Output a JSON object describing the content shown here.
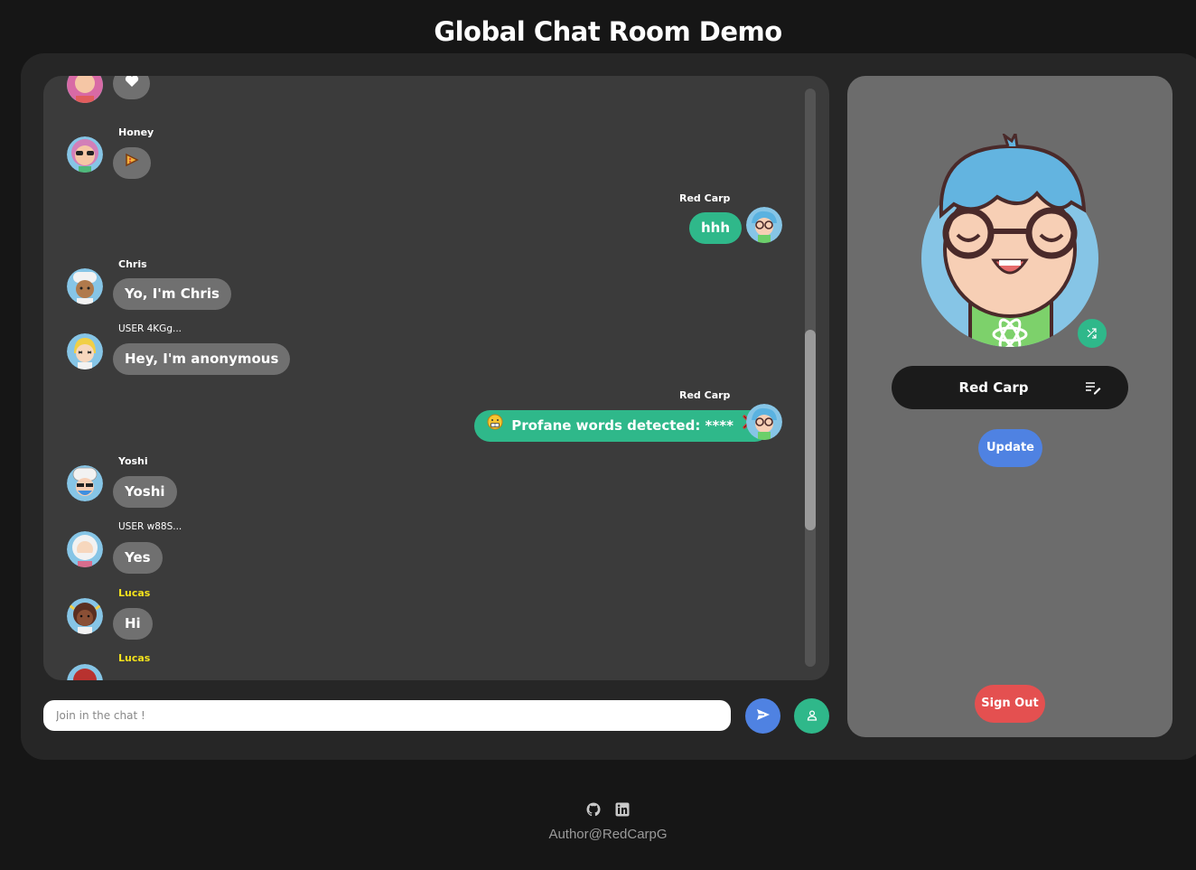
{
  "page": {
    "title": "Global Chat Room Demo"
  },
  "chat": {
    "messages": [
      {
        "sender": "",
        "text": "",
        "icon": "heart-icon",
        "side": "left"
      },
      {
        "sender": "Honey",
        "text": "",
        "icon": "pizza-icon",
        "side": "left"
      },
      {
        "sender": "Red Carp",
        "text": "hhh",
        "side": "right"
      },
      {
        "sender": "Chris",
        "text": "Yo, I'm Chris",
        "side": "left"
      },
      {
        "sender": "USER 4KGg...",
        "text": "Hey, I'm anonymous",
        "side": "left"
      },
      {
        "sender": "Red Carp",
        "text": "Profane words detected: ****",
        "icon": "grimace-emoji-icon",
        "trail_icon": "cross-mark-icon",
        "side": "right"
      },
      {
        "sender": "Yoshi",
        "text": "Yoshi",
        "side": "left"
      },
      {
        "sender": "USER w88S...",
        "text": "Yes",
        "side": "left"
      },
      {
        "sender": "Lucas",
        "text": "Hi",
        "side": "left"
      },
      {
        "sender": "Lucas",
        "text": "",
        "side": "left"
      }
    ]
  },
  "composer": {
    "placeholder": "Join in the chat !",
    "send_icon": "send-icon",
    "login_icon": "user-icon"
  },
  "profile": {
    "username": "Red Carp",
    "update_label": "Update",
    "signout_label": "Sign Out",
    "shuffle_icon": "shuffle-icon",
    "edit_icon": "edit-icon"
  },
  "footer": {
    "author": "Author@RedCarpG",
    "icons": [
      "github-icon",
      "linkedin-icon"
    ]
  },
  "colors": {
    "page_bg": "#161616",
    "panel_bg": "#262626",
    "chat_bg": "#3b3b3b",
    "profile_bg": "#6c6c6c",
    "bubble_grey": "#707070",
    "bubble_green": "#2fb88a",
    "update_blue": "#4f82e2",
    "signout_red": "#e45050",
    "highlight_name": "#f4e21c"
  }
}
